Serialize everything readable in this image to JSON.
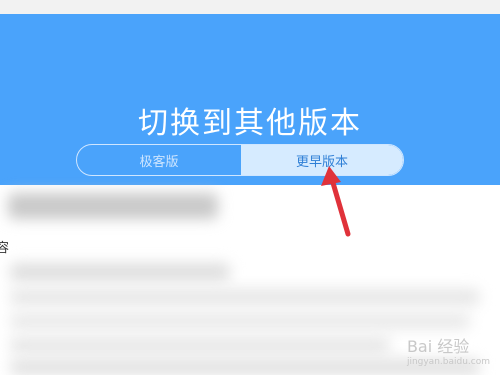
{
  "hero": {
    "title": "切换到其他版本",
    "toggle_left": "极客版",
    "toggle_right": "更早版本"
  },
  "content": {
    "label1": "容"
  },
  "watermark": {
    "brand": "Bai 经验",
    "url": "jingyan.baidu.com"
  },
  "colors": {
    "hero_bg": "#4aa3fb",
    "toggle_selected_bg": "#d6ebff",
    "arrow": "#e0323a"
  }
}
